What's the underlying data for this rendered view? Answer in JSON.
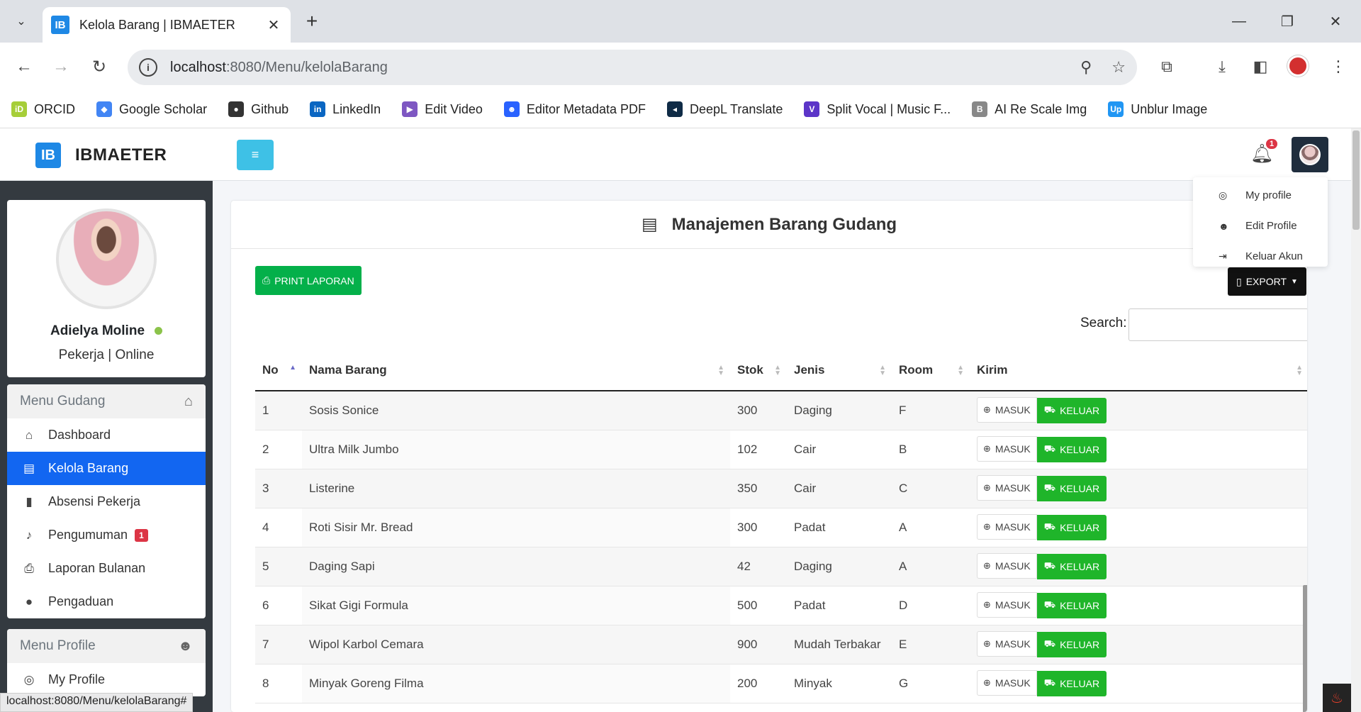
{
  "browser": {
    "tab_favicon": "IB",
    "tab_title": "Kelola Barang | IBMAETER",
    "url_host": "localhost",
    "url_rest": ":8080/Menu/kelolaBarang",
    "status_url": "localhost:8080/Menu/kelolaBarang#",
    "bookmarks": [
      {
        "label": "ORCID",
        "icon": "orcid-icon",
        "color": "#a6ce39",
        "glyph": "iD"
      },
      {
        "label": "Google Scholar",
        "icon": "scholar-icon",
        "color": "#4285f4",
        "glyph": "◆"
      },
      {
        "label": "Github",
        "icon": "github-icon",
        "color": "#333333",
        "glyph": "●"
      },
      {
        "label": "LinkedIn",
        "icon": "linkedin-icon",
        "color": "#0a66c2",
        "glyph": "in"
      },
      {
        "label": "Edit Video",
        "icon": "video-icon",
        "color": "#7e57c2",
        "glyph": "▶"
      },
      {
        "label": "Editor Metadata PDF",
        "icon": "people-icon",
        "color": "#2962ff",
        "glyph": "☻"
      },
      {
        "label": "DeepL Translate",
        "icon": "deepl-icon",
        "color": "#0f2b46",
        "glyph": "◂"
      },
      {
        "label": "Split Vocal | Music F...",
        "icon": "v-icon",
        "color": "#5c35c8",
        "glyph": "V"
      },
      {
        "label": "AI Re Scale Img",
        "icon": "b-icon",
        "color": "#888888",
        "glyph": "B"
      },
      {
        "label": "Unblur Image",
        "icon": "up-icon",
        "color": "#2196f3",
        "glyph": "Up"
      }
    ]
  },
  "header": {
    "brand_logo": "IB",
    "brand_name": "IBMAETER",
    "notification_count": "1"
  },
  "dropdown": {
    "items": [
      "My profile",
      "Edit Profile",
      "Keluar Akun"
    ]
  },
  "profile": {
    "name": "Adielya Moline",
    "role": "Pekerja | Online"
  },
  "menu_gudang": {
    "title": "Menu Gudang",
    "items": [
      {
        "label": "Dashboard",
        "icon": "home-icon"
      },
      {
        "label": "Kelola Barang",
        "icon": "box-icon"
      },
      {
        "label": "Absensi Pekerja",
        "icon": "clipboard-icon"
      },
      {
        "label": "Pengumuman",
        "icon": "bell-icon",
        "badge": "1"
      },
      {
        "label": "Laporan Bulanan",
        "icon": "printer-icon"
      },
      {
        "label": "Pengaduan",
        "icon": "chat-icon"
      }
    ]
  },
  "menu_profile": {
    "title": "Menu Profile",
    "items": [
      {
        "label": "My Profile",
        "icon": "user-circle-icon"
      }
    ]
  },
  "main": {
    "title": "Manajemen Barang Gudang",
    "print_label": "PRINT LAPORAN",
    "export_label": "EXPORT",
    "search_label": "Search:",
    "search_value": "",
    "columns": [
      "No",
      "Nama Barang",
      "Stok",
      "Jenis",
      "Room",
      "Kirim"
    ],
    "masuk_label": "MASUK",
    "keluar_label": "KELUAR",
    "rows": [
      {
        "no": "1",
        "nama": "Sosis Sonice",
        "stok": "300",
        "jenis": "Daging",
        "room": "F"
      },
      {
        "no": "2",
        "nama": "Ultra Milk Jumbo",
        "stok": "102",
        "jenis": "Cair",
        "room": "B"
      },
      {
        "no": "3",
        "nama": "Listerine",
        "stok": "350",
        "jenis": "Cair",
        "room": "C"
      },
      {
        "no": "4",
        "nama": "Roti Sisir Mr. Bread",
        "stok": "300",
        "jenis": "Padat",
        "room": "A"
      },
      {
        "no": "5",
        "nama": "Daging Sapi",
        "stok": "42",
        "jenis": "Daging",
        "room": "A"
      },
      {
        "no": "6",
        "nama": "Sikat Gigi Formula",
        "stok": "500",
        "jenis": "Padat",
        "room": "D"
      },
      {
        "no": "7",
        "nama": "Wipol Karbol Cemara",
        "stok": "900",
        "jenis": "Mudah Terbakar",
        "room": "E"
      },
      {
        "no": "8",
        "nama": "Minyak Goreng Filma",
        "stok": "200",
        "jenis": "Minyak",
        "room": "G"
      }
    ]
  },
  "colors": {
    "accent_blue": "#1266f1",
    "hamburger": "#3ec1e6",
    "print_green": "#04b04a",
    "keluar_green": "#1fb52a",
    "sidebar_dark": "#343a40"
  }
}
